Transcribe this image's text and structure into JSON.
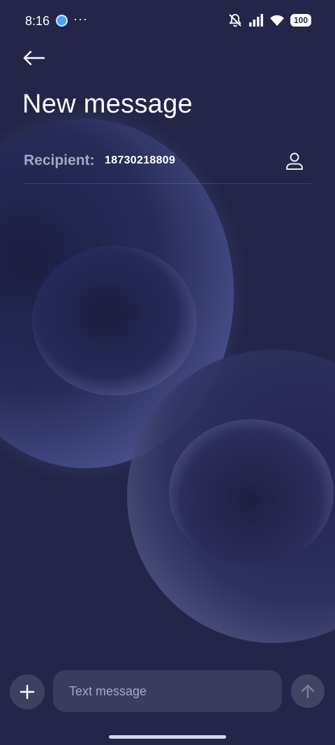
{
  "status_bar": {
    "time": "8:16",
    "more": "···",
    "battery": "100"
  },
  "header": {
    "title": "New message"
  },
  "recipient": {
    "label": "Recipient:",
    "value": "18730218809"
  },
  "compose": {
    "placeholder": "Text message"
  },
  "icons": {
    "back": "arrow-left-icon",
    "contact": "person-icon",
    "add": "plus-icon",
    "send": "arrow-up-icon",
    "mute": "bell-off-icon",
    "signal": "signal-icon",
    "wifi": "wifi-icon"
  },
  "colors": {
    "background": "#232649",
    "label": "#a4a7c4",
    "placeholder": "#a5a8c6"
  }
}
